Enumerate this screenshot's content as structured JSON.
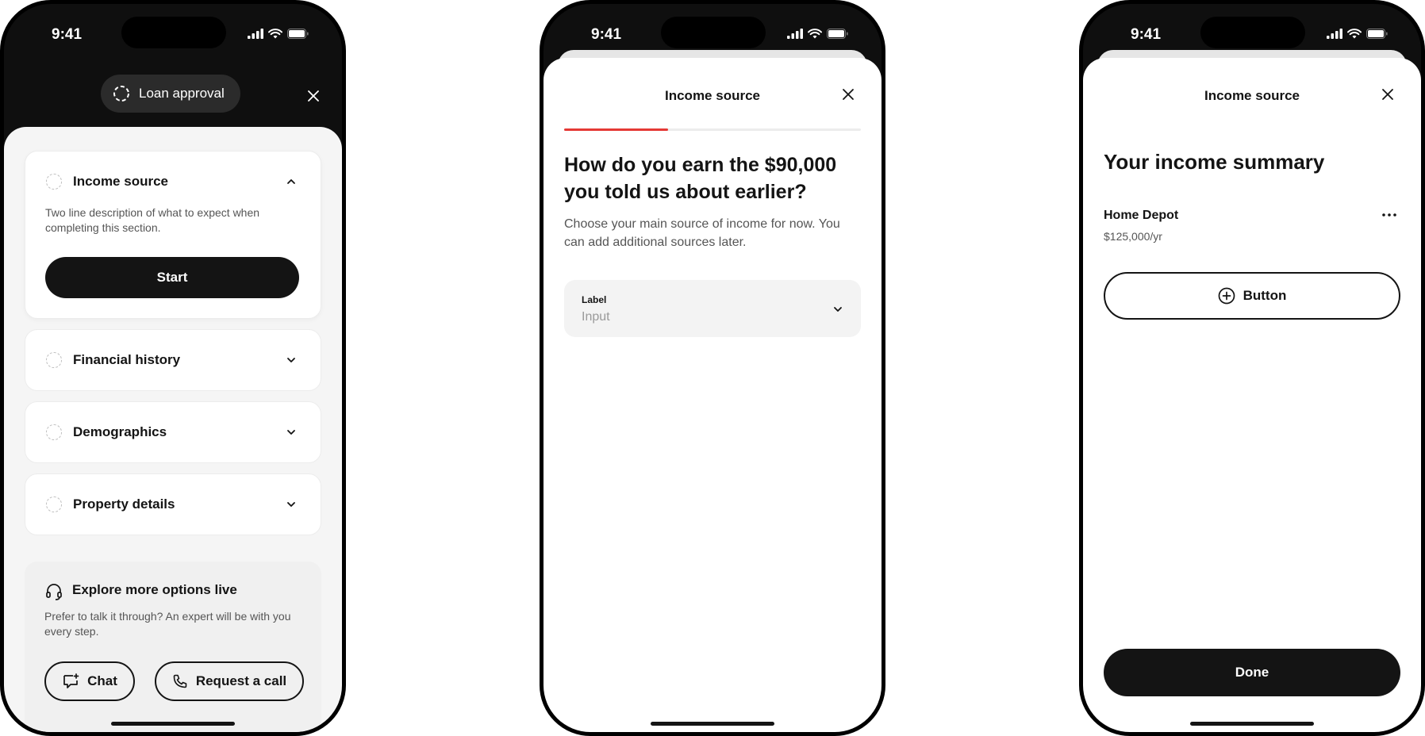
{
  "status_bar": {
    "time": "9:41"
  },
  "screen1": {
    "header_pill_label": "Loan approval",
    "sections": [
      {
        "title": "Income source",
        "description": "Two line description of what to expect when completing this section.",
        "button_label": "Start",
        "expanded": true
      },
      {
        "title": "Financial history",
        "expanded": false
      },
      {
        "title": "Demographics",
        "expanded": false
      },
      {
        "title": "Property details",
        "expanded": false
      }
    ],
    "help": {
      "title": "Explore more options live",
      "description": "Prefer to talk it through? An expert will be with you every step.",
      "chat_label": "Chat",
      "call_label": "Request a call"
    }
  },
  "screen2": {
    "modal_title": "Income source",
    "progress": 0.35,
    "heading": "How do you earn the $90,000 you told us about earlier?",
    "subtext": "Choose your main source of income for now. You can add additional sources later.",
    "field_label": "Label",
    "field_placeholder": "Input"
  },
  "screen3": {
    "modal_title": "Income source",
    "heading": "Your income summary",
    "income_name": "Home Depot",
    "income_amount": "$125,000/yr",
    "add_button_label": "Button",
    "done_label": "Done"
  },
  "colors": {
    "progress_accent": "#e53935",
    "primary_button": "#141414",
    "header_dark": "#0f0f0f"
  },
  "icons": {
    "close": "close-icon",
    "chevron_up": "chevron-up-icon",
    "chevron_down": "chevron-down-icon",
    "headset": "headset-icon",
    "chat": "chat-icon",
    "phone": "phone-icon",
    "more": "more-horizontal-icon",
    "plus_circle": "plus-circle-icon",
    "spinner": "loading-spinner-icon"
  }
}
